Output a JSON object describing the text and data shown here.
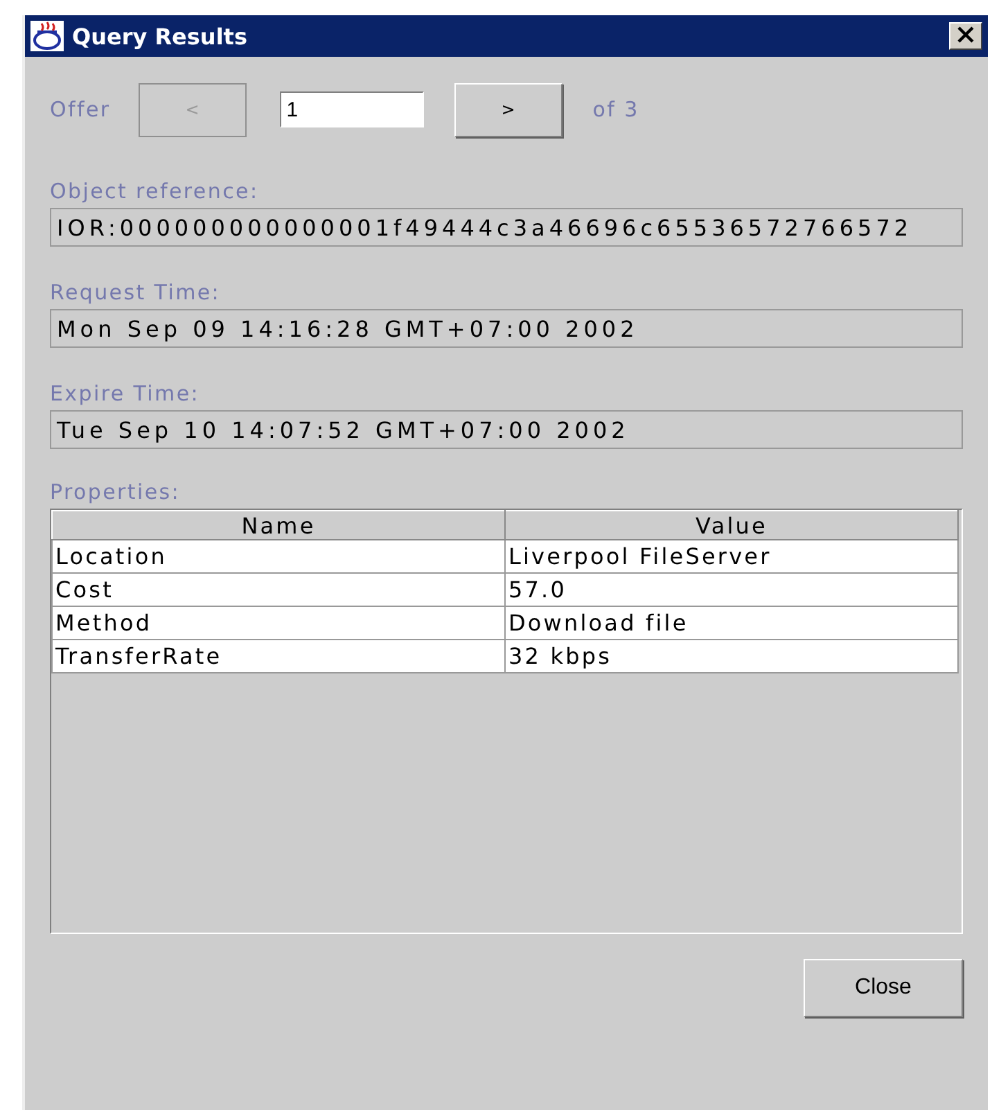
{
  "window": {
    "title": "Query Results"
  },
  "pager": {
    "label": "Offer",
    "prev": {
      "label": "<",
      "disabled": true
    },
    "value": "1",
    "next": {
      "label": ">",
      "disabled": false
    },
    "total": "of 3"
  },
  "fields": [
    {
      "label": "Object reference:",
      "value": "IOR:000000000000001f49444c3a46696c65536572766572"
    },
    {
      "label": "Request Time:",
      "value": "Mon Sep 09 14:16:28 GMT+07:00 2002"
    },
    {
      "label": "Expire Time:",
      "value": "Tue Sep 10 14:07:52 GMT+07:00 2002"
    }
  ],
  "properties": {
    "label": "Properties:",
    "columns": [
      "Name",
      "Value"
    ],
    "rows": [
      [
        "Location",
        "Liverpool FileServer"
      ],
      [
        "Cost",
        "57.0"
      ],
      [
        "Method",
        "Download file"
      ],
      [
        "TransferRate",
        "32 kbps"
      ]
    ]
  },
  "buttons": [
    "Close"
  ]
}
